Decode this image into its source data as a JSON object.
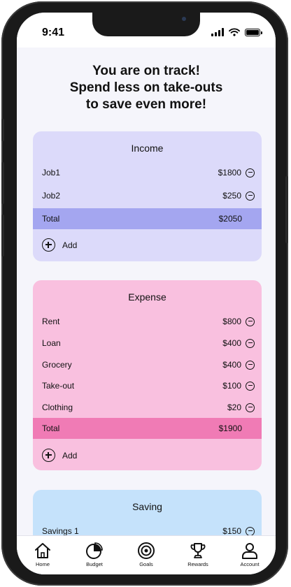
{
  "status_bar": {
    "time": "9:41"
  },
  "headline": {
    "line1": "You are on track!",
    "line2": "Spend less on take-outs",
    "line3": "to save even more!"
  },
  "income": {
    "title": "Income",
    "rows": [
      {
        "label": "Job1",
        "amount": "$1800"
      },
      {
        "label": "Job2",
        "amount": "$250"
      }
    ],
    "total_label": "Total",
    "total_amount": "$2050",
    "add_label": "Add"
  },
  "expense": {
    "title": "Expense",
    "rows": [
      {
        "label": "Rent",
        "amount": "$800"
      },
      {
        "label": "Loan",
        "amount": "$400"
      },
      {
        "label": "Grocery",
        "amount": "$400"
      },
      {
        "label": "Take-out",
        "amount": "$100"
      },
      {
        "label": "Clothing",
        "amount": "$20"
      }
    ],
    "total_label": "Total",
    "total_amount": "$1900",
    "add_label": "Add"
  },
  "saving": {
    "title": "Saving",
    "rows": [
      {
        "label": "Savings 1",
        "amount": "$150"
      }
    ]
  },
  "nav": {
    "items": [
      {
        "label": "Home",
        "icon": "home-icon"
      },
      {
        "label": "Budget",
        "icon": "pie-chart-icon"
      },
      {
        "label": "Goals",
        "icon": "target-icon"
      },
      {
        "label": "Rewards",
        "icon": "trophy-icon"
      },
      {
        "label": "Account",
        "icon": "user-icon"
      }
    ]
  },
  "colors": {
    "income_card": "#dcdafa",
    "income_total": "#a4a6f0",
    "expense_card": "#f9c0df",
    "expense_total": "#f07bb5",
    "saving_card": "#c5e2fb",
    "screen_bg": "#f5f5fb"
  }
}
